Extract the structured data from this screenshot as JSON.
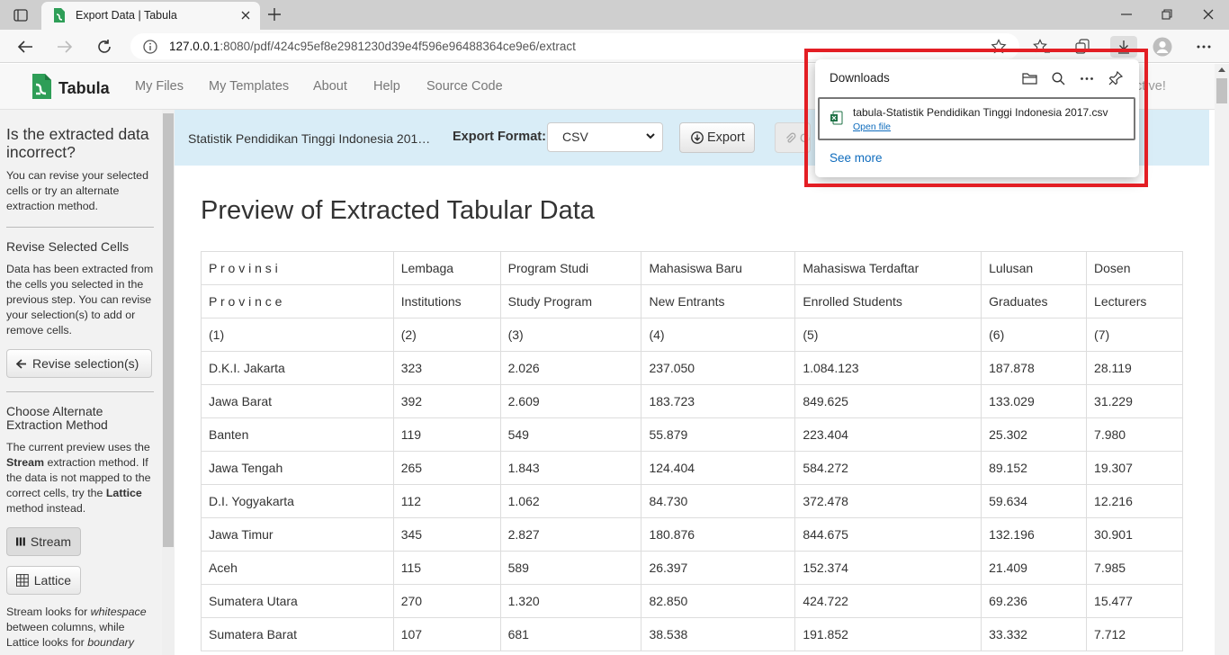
{
  "browser": {
    "tab_title": "Export Data | Tabula",
    "url_host": "127.0.0.1",
    "url_rest": ":8080/pdf/424c95ef8e2981230d39e4f596e96488364ce9e6/extract"
  },
  "app": {
    "brand": "Tabula",
    "nav": [
      "My Files",
      "My Templates",
      "About",
      "Help",
      "Source Code"
    ],
    "nav_tail": "ctive!"
  },
  "sidebar": {
    "heading": "Is the extracted data incorrect?",
    "intro": "You can revise your selected cells or try an alternate extraction method.",
    "revise_heading": "Revise Selected Cells",
    "revise_text": "Data has been extracted from the cells you selected in the previous step. You can revise your selection(s) to add or remove cells.",
    "revise_button": "Revise selection(s)",
    "method_heading": "Choose Alternate Extraction Method",
    "method_text_1": "The current preview uses the ",
    "method_bold_1": "Stream",
    "method_text_2": " extraction method. If the data is not mapped to the correct cells, try the ",
    "method_bold_2": "Lattice",
    "method_text_3": " method instead.",
    "stream_button": "Stream",
    "lattice_button": "Lattice",
    "foot_1": "Stream looks for ",
    "foot_em_1": "whitespace",
    "foot_2": " between columns, while Lattice looks for ",
    "foot_em_2": "boundary"
  },
  "export_bar": {
    "file_name": "Statistik Pendidikan Tinggi Indonesia 201…",
    "format_label": "Export Format:",
    "format_value": "CSV",
    "export_button": "Export",
    "copy_button": "Copy to Clipboard"
  },
  "preview": {
    "title": "Preview of Extracted Tabular Data",
    "rows": [
      [
        "P r o v i n s i",
        "Lembaga",
        "Program Studi",
        "Mahasiswa Baru",
        "Mahasiswa Terdaftar",
        "Lulusan",
        "Dosen"
      ],
      [
        "P r o v i n c e",
        "Institutions",
        "Study Program",
        "New Entrants",
        "Enrolled Students",
        "Graduates",
        "Lecturers"
      ],
      [
        "(1)",
        "(2)",
        "(3)",
        "(4)",
        "(5)",
        "(6)",
        "(7)"
      ],
      [
        "D.K.I. Jakarta",
        "323",
        "2.026",
        "237.050",
        "1.084.123",
        "187.878",
        "28.119"
      ],
      [
        "Jawa Barat",
        "392",
        "2.609",
        "183.723",
        "849.625",
        "133.029",
        "31.229"
      ],
      [
        "Banten",
        "119",
        "549",
        "55.879",
        "223.404",
        "25.302",
        "7.980"
      ],
      [
        "Jawa Tengah",
        "265",
        "1.843",
        "124.404",
        "584.272",
        "89.152",
        "19.307"
      ],
      [
        "D.I. Yogyakarta",
        "112",
        "1.062",
        "84.730",
        "372.478",
        "59.634",
        "12.216"
      ],
      [
        "Jawa Timur",
        "345",
        "2.827",
        "180.876",
        "844.675",
        "132.196",
        "30.901"
      ],
      [
        "Aceh",
        "115",
        "589",
        "26.397",
        "152.374",
        "21.409",
        "7.985"
      ],
      [
        "Sumatera Utara",
        "270",
        "1.320",
        "82.850",
        "424.722",
        "69.236",
        "15.477"
      ],
      [
        "Sumatera Barat",
        "107",
        "681",
        "38.538",
        "191.852",
        "33.332",
        "7.712"
      ]
    ]
  },
  "downloads": {
    "title": "Downloads",
    "file_name": "tabula-Statistik Pendidikan Tinggi Indonesia 2017.csv",
    "open_file": "Open file",
    "see_more": "See more"
  },
  "colors": {
    "highlight": "#e31e24",
    "export_bar_bg": "#d9edf7",
    "link_blue": "#0f6cbd"
  }
}
